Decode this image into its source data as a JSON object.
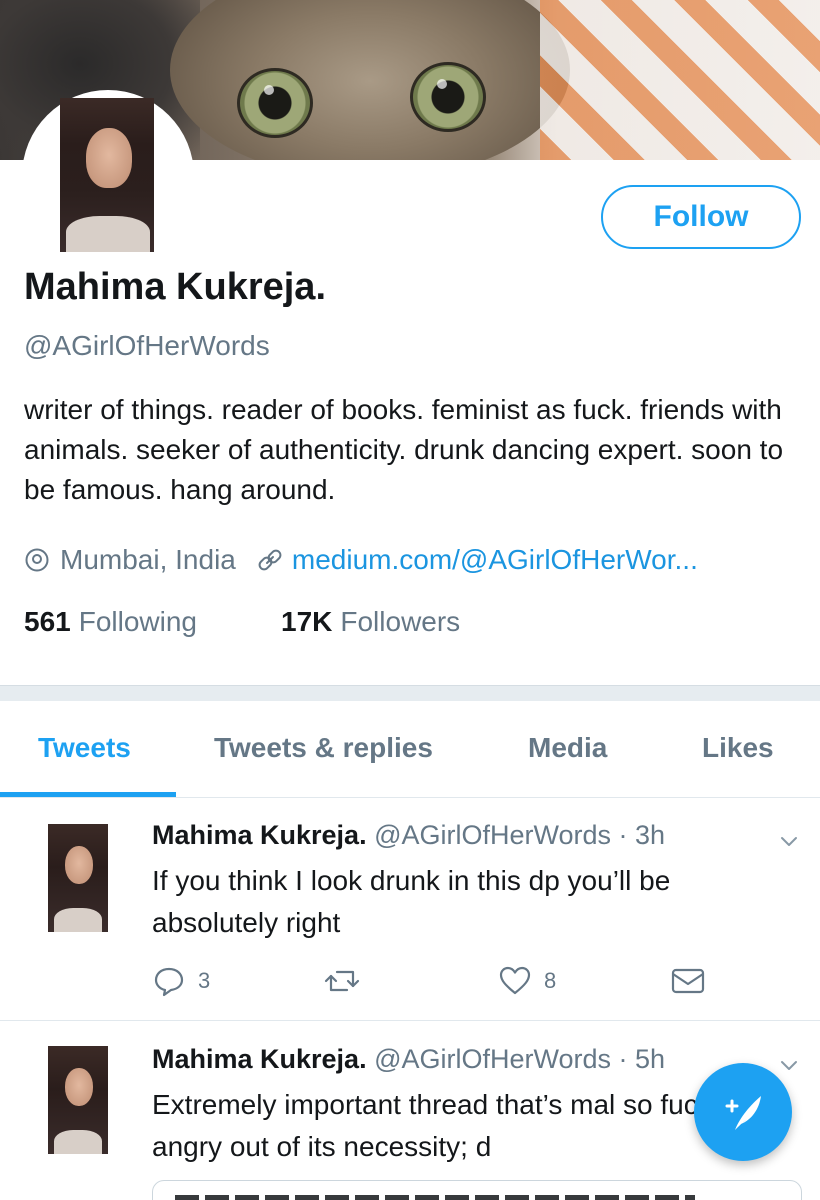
{
  "profile": {
    "display_name": "Mahima Kukreja.",
    "handle": "@AGirlOfHerWords",
    "bio": "writer of things. reader of books. feminist as fuck. friends with animals. seeker of authenticity. drunk dancing expert. soon to be famous. hang around.",
    "location": "Mumbai, India",
    "link": "medium.com/@AGirlOfHerWor...",
    "following_count": "561",
    "following_label": "Following",
    "followers_count": "17K",
    "followers_label": "Followers",
    "follow_button": "Follow",
    "banner_icon": "cat-photo",
    "avatar_icon": "profile-photo"
  },
  "tabs": [
    {
      "label": "Tweets",
      "active": true
    },
    {
      "label": "Tweets & replies",
      "active": false
    },
    {
      "label": "Media",
      "active": false
    },
    {
      "label": "Likes",
      "active": false
    }
  ],
  "tweets": [
    {
      "name": "Mahima Kukreja.",
      "handle_time": "@AGirlOfHerWords · 3h",
      "text": "If you think I look drunk in this dp you’ll be absolutely right",
      "reply_count": "3",
      "retweet_count": "",
      "like_count": "8"
    },
    {
      "name": "Mahima Kukreja.",
      "handle_time": "@AGirlOfHerWords · 5h",
      "text": "Extremely important thread that’s mal so fucking angry out of its necessity; d"
    }
  ],
  "colors": {
    "accent": "#1da1f2",
    "link": "#1b95e0",
    "muted": "#657786",
    "text": "#14171a"
  },
  "icons": {
    "location": "location-pin-icon",
    "link": "link-icon",
    "reply": "reply-icon",
    "retweet": "retweet-icon",
    "like": "heart-icon",
    "message": "envelope-icon",
    "caret": "chevron-down-icon",
    "compose": "compose-tweet-icon"
  }
}
